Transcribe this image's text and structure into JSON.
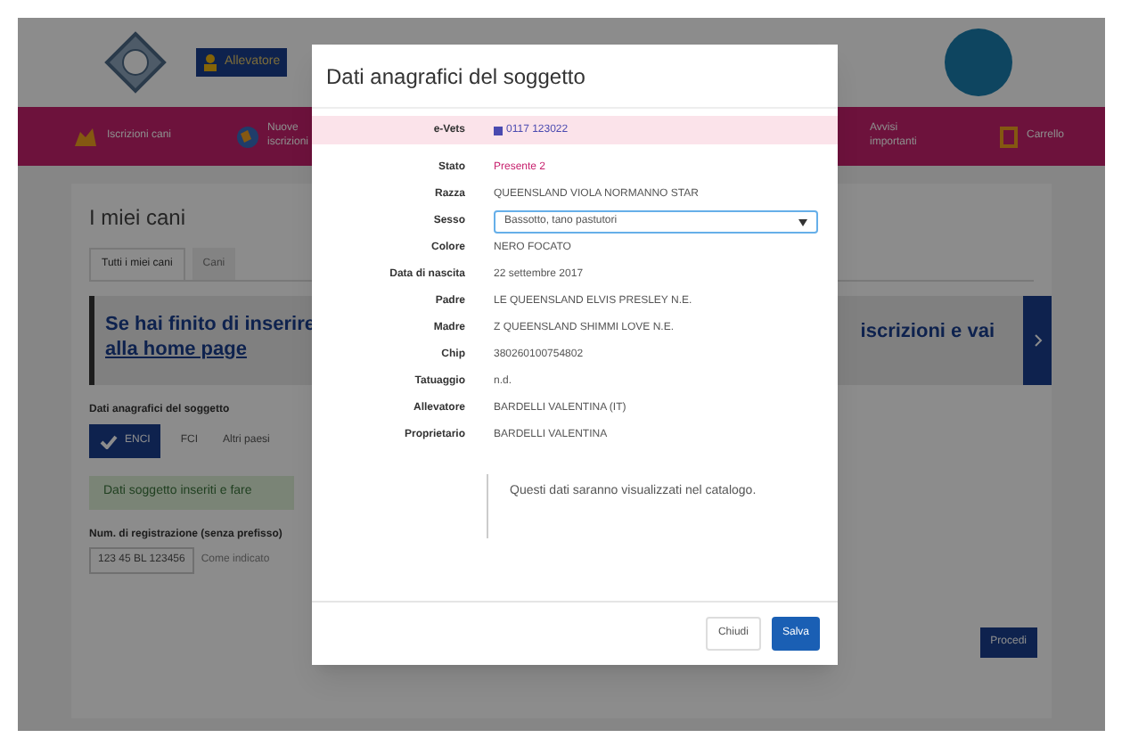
{
  "header": {
    "account": "Allevatore"
  },
  "nav": [
    {
      "label": "Iscrizioni cani"
    },
    {
      "label": "Nuove iscrizioni"
    },
    {
      "label": "Avvisi importanti"
    },
    {
      "label": "Carrello"
    }
  ],
  "page": {
    "title": "I miei cani",
    "tabs": [
      {
        "label": "Tutti i miei cani",
        "selected": true
      },
      {
        "label": "Cani",
        "selected": false
      }
    ],
    "notice": {
      "left_1": "Se hai finito di inserire",
      "left_2": "alla home page",
      "right": "iscrizioni e vai"
    },
    "registry_label": "Dati anagrafici del soggetto",
    "registries": [
      {
        "label": "ENCI",
        "selected": true
      },
      {
        "label": "FCI",
        "selected": false
      },
      {
        "label": "Altri paesi",
        "selected": false
      }
    ],
    "success": "Dati soggetto inseriti e fare",
    "reg_label": "Num. di registrazione (senza prefisso)",
    "reg_value": "123 45 BL 123456",
    "reg_hint": "Come indicato",
    "proceed": "Procedi"
  },
  "modal": {
    "title": "Dati anagrafici del soggetto",
    "rows": [
      {
        "label": "e-Vets",
        "value": "0117 123022",
        "kind": "chip",
        "highlighted": true
      },
      {
        "label": "Stato",
        "value": "Presente 2",
        "kind": "link",
        "highlighted": false
      },
      {
        "label": "Razza",
        "value": "QUEENSLAND VIOLA NORMANNO STAR",
        "kind": "text",
        "highlighted": false
      },
      {
        "label": "Sesso",
        "value": "Bassotto, tano pastutori",
        "kind": "select",
        "highlighted": false
      },
      {
        "label": "Colore",
        "value": "NERO FOCATO",
        "kind": "text",
        "highlighted": false
      },
      {
        "label": "Data di nascita",
        "value": "22 settembre 2017",
        "kind": "text",
        "highlighted": false
      },
      {
        "label": "Padre",
        "value": "LE QUEENSLAND ELVIS PRESLEY N.E.",
        "kind": "text",
        "highlighted": false
      },
      {
        "label": "Madre",
        "value": "Z QUEENSLAND SHIMMI LOVE N.E.",
        "kind": "text",
        "highlighted": false
      },
      {
        "label": "Chip",
        "value": "380260100754802",
        "kind": "text",
        "highlighted": false
      },
      {
        "label": "Tatuaggio",
        "value": "n.d.",
        "kind": "text",
        "highlighted": false
      },
      {
        "label": "Allevatore",
        "value": "BARDELLI VALENTINA (IT)",
        "kind": "text",
        "highlighted": false
      },
      {
        "label": "Proprietario",
        "value": "BARDELLI VALENTINA",
        "kind": "text",
        "highlighted": false
      }
    ],
    "note": "Questi dati saranno visualizzati nel catalogo.",
    "buttons": [
      {
        "label": "Chiudi",
        "kind": "secondary"
      },
      {
        "label": "Salva",
        "kind": "primary"
      }
    ]
  }
}
